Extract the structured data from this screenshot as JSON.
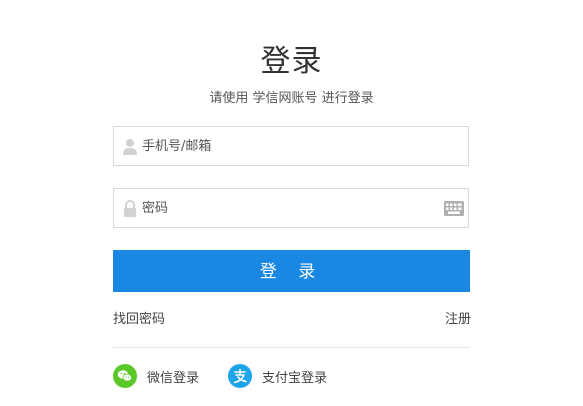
{
  "header": {
    "title": "登录",
    "subtitle": "请使用 学信网账号 进行登录"
  },
  "form": {
    "username_placeholder": "手机号/邮箱",
    "password_placeholder": "密码",
    "login_button": "登 录"
  },
  "links": {
    "forgot_password": "找回密码",
    "register": "注册"
  },
  "social": {
    "wechat_label": "微信登录",
    "alipay_label": "支付宝登录"
  },
  "colors": {
    "primary": "#1a87e3",
    "wechat": "#5ac828",
    "alipay": "#1fa3e8"
  },
  "icons": {
    "username": "user-icon",
    "password": "lock-icon",
    "keyboard": "keyboard-icon",
    "wechat": "wechat-icon",
    "alipay": "alipay-icon"
  }
}
